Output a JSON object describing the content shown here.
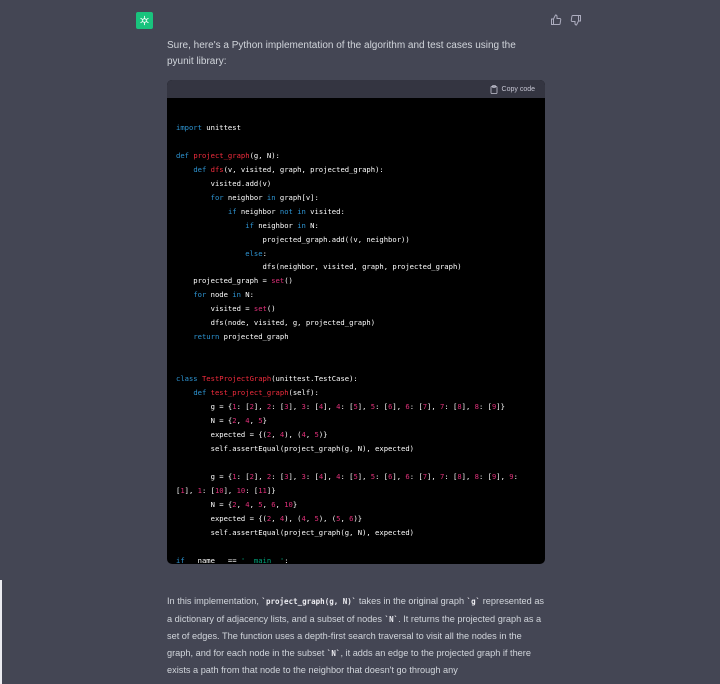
{
  "assistant": {
    "intro": "Sure, here's a Python implementation of the algorithm and test cases using the pyunit library:"
  },
  "code_block": {
    "copy_label": "Copy code",
    "lines": [
      [],
      [
        [
          "import",
          "k"
        ],
        [
          " unittest",
          ""
        ]
      ],
      [],
      [
        [
          "def",
          "k"
        ],
        [
          " ",
          ""
        ],
        [
          "project_graph",
          "f"
        ],
        [
          "(g, N):",
          ""
        ]
      ],
      [
        [
          "    ",
          ""
        ],
        [
          "def",
          "k"
        ],
        [
          " ",
          ""
        ],
        [
          "dfs",
          "f"
        ],
        [
          "(v, visited, graph, projected_graph):",
          ""
        ]
      ],
      [
        [
          "        visited.add(v)",
          ""
        ]
      ],
      [
        [
          "        ",
          ""
        ],
        [
          "for",
          "k"
        ],
        [
          " neighbor ",
          ""
        ],
        [
          "in",
          "k"
        ],
        [
          " graph[v]:",
          ""
        ]
      ],
      [
        [
          "            ",
          ""
        ],
        [
          "if",
          "k"
        ],
        [
          " neighbor ",
          ""
        ],
        [
          "not",
          "k"
        ],
        [
          " ",
          ""
        ],
        [
          "in",
          "k"
        ],
        [
          " visited:",
          ""
        ]
      ],
      [
        [
          "                ",
          ""
        ],
        [
          "if",
          "k"
        ],
        [
          " neighbor ",
          ""
        ],
        [
          "in",
          "k"
        ],
        [
          " N:",
          ""
        ]
      ],
      [
        [
          "                    projected_graph.add((v, neighbor))",
          ""
        ]
      ],
      [
        [
          "                ",
          ""
        ],
        [
          "else",
          "k"
        ],
        [
          ":",
          ""
        ]
      ],
      [
        [
          "                    dfs(neighbor, visited, graph, projected_graph)",
          ""
        ]
      ],
      [
        [
          "    projected_graph = ",
          ""
        ],
        [
          "set",
          "n"
        ],
        [
          "()",
          ""
        ]
      ],
      [
        [
          "    ",
          ""
        ],
        [
          "for",
          "k"
        ],
        [
          " node ",
          ""
        ],
        [
          "in",
          "k"
        ],
        [
          " N:",
          ""
        ]
      ],
      [
        [
          "        visited = ",
          ""
        ],
        [
          "set",
          "n"
        ],
        [
          "()",
          ""
        ]
      ],
      [
        [
          "        dfs(node, visited, g, projected_graph)",
          ""
        ]
      ],
      [
        [
          "    ",
          ""
        ],
        [
          "return",
          "k"
        ],
        [
          " projected_graph",
          ""
        ]
      ],
      [],
      [],
      [
        [
          "class",
          "k"
        ],
        [
          " ",
          ""
        ],
        [
          "TestProjectGraph",
          "f"
        ],
        [
          "(unittest.TestCase):",
          ""
        ]
      ],
      [
        [
          "    ",
          ""
        ],
        [
          "def",
          "k"
        ],
        [
          " ",
          ""
        ],
        [
          "test_project_graph",
          "f"
        ],
        [
          "(self):",
          ""
        ]
      ],
      [
        [
          "        g = {",
          ""
        ],
        [
          "1",
          "n"
        ],
        [
          ": [",
          ""
        ],
        [
          "2",
          "n"
        ],
        [
          "], ",
          ""
        ],
        [
          "2",
          "n"
        ],
        [
          ": [",
          ""
        ],
        [
          "3",
          "n"
        ],
        [
          "], ",
          ""
        ],
        [
          "3",
          "n"
        ],
        [
          ": [",
          ""
        ],
        [
          "4",
          "n"
        ],
        [
          "], ",
          ""
        ],
        [
          "4",
          "n"
        ],
        [
          ": [",
          ""
        ],
        [
          "5",
          "n"
        ],
        [
          "], ",
          ""
        ],
        [
          "5",
          "n"
        ],
        [
          ": [",
          ""
        ],
        [
          "6",
          "n"
        ],
        [
          "], ",
          ""
        ],
        [
          "6",
          "n"
        ],
        [
          ": [",
          ""
        ],
        [
          "7",
          "n"
        ],
        [
          "], ",
          ""
        ],
        [
          "7",
          "n"
        ],
        [
          ": [",
          ""
        ],
        [
          "8",
          "n"
        ],
        [
          "], ",
          ""
        ],
        [
          "8",
          "n"
        ],
        [
          ": [",
          ""
        ],
        [
          "9",
          "n"
        ],
        [
          "]}",
          ""
        ]
      ],
      [
        [
          "        N = {",
          ""
        ],
        [
          "2",
          "n"
        ],
        [
          ", ",
          ""
        ],
        [
          "4",
          "n"
        ],
        [
          ", ",
          ""
        ],
        [
          "5",
          "n"
        ],
        [
          "}",
          ""
        ]
      ],
      [
        [
          "        expected = {(",
          ""
        ],
        [
          "2",
          "n"
        ],
        [
          ", ",
          ""
        ],
        [
          "4",
          "n"
        ],
        [
          "), (",
          ""
        ],
        [
          "4",
          "n"
        ],
        [
          ", ",
          ""
        ],
        [
          "5",
          "n"
        ],
        [
          ")}",
          ""
        ]
      ],
      [
        [
          "        self.assertEqual(project_graph(g, N), expected)",
          ""
        ]
      ],
      [],
      [
        [
          "        g = {",
          ""
        ],
        [
          "1",
          "n"
        ],
        [
          ": [",
          ""
        ],
        [
          "2",
          "n"
        ],
        [
          "], ",
          ""
        ],
        [
          "2",
          "n"
        ],
        [
          ": [",
          ""
        ],
        [
          "3",
          "n"
        ],
        [
          "], ",
          ""
        ],
        [
          "3",
          "n"
        ],
        [
          ": [",
          ""
        ],
        [
          "4",
          "n"
        ],
        [
          "], ",
          ""
        ],
        [
          "4",
          "n"
        ],
        [
          ": [",
          ""
        ],
        [
          "5",
          "n"
        ],
        [
          "], ",
          ""
        ],
        [
          "5",
          "n"
        ],
        [
          ": [",
          ""
        ],
        [
          "6",
          "n"
        ],
        [
          "], ",
          ""
        ],
        [
          "6",
          "n"
        ],
        [
          ": [",
          ""
        ],
        [
          "7",
          "n"
        ],
        [
          "], ",
          ""
        ],
        [
          "7",
          "n"
        ],
        [
          ": [",
          ""
        ],
        [
          "8",
          "n"
        ],
        [
          "], ",
          ""
        ],
        [
          "8",
          "n"
        ],
        [
          ": [",
          ""
        ],
        [
          "9",
          "n"
        ],
        [
          "], ",
          ""
        ],
        [
          "9",
          "n"
        ],
        [
          ":",
          ""
        ]
      ],
      [
        [
          "[",
          ""
        ],
        [
          "1",
          "n"
        ],
        [
          "], ",
          ""
        ],
        [
          "1",
          "n"
        ],
        [
          ": [",
          ""
        ],
        [
          "10",
          "n"
        ],
        [
          "], ",
          ""
        ],
        [
          "10",
          "n"
        ],
        [
          ": [",
          ""
        ],
        [
          "11",
          "n"
        ],
        [
          "]}",
          ""
        ]
      ],
      [
        [
          "        N = {",
          ""
        ],
        [
          "2",
          "n"
        ],
        [
          ", ",
          ""
        ],
        [
          "4",
          "n"
        ],
        [
          ", ",
          ""
        ],
        [
          "5",
          "n"
        ],
        [
          ", ",
          ""
        ],
        [
          "6",
          "n"
        ],
        [
          ", ",
          ""
        ],
        [
          "10",
          "n"
        ],
        [
          "}",
          ""
        ]
      ],
      [
        [
          "        expected = {(",
          ""
        ],
        [
          "2",
          "n"
        ],
        [
          ", ",
          ""
        ],
        [
          "4",
          "n"
        ],
        [
          "), (",
          ""
        ],
        [
          "4",
          "n"
        ],
        [
          ", ",
          ""
        ],
        [
          "5",
          "n"
        ],
        [
          "), (",
          ""
        ],
        [
          "5",
          "n"
        ],
        [
          ", ",
          ""
        ],
        [
          "6",
          "n"
        ],
        [
          ")}",
          ""
        ]
      ],
      [
        [
          "        self.assertEqual(project_graph(g, N), expected)",
          ""
        ]
      ],
      [],
      [
        [
          "if",
          "k"
        ],
        [
          " __name__ == ",
          ""
        ],
        [
          "'__main__'",
          "s"
        ],
        [
          ":",
          ""
        ]
      ],
      [
        [
          "    unittest.main()",
          ""
        ]
      ]
    ]
  },
  "explanation": {
    "p1": "In this implementation, ",
    "c1": "`project_graph(g, N)`",
    "p2": " takes in the original graph ",
    "c2": "`g`",
    "p3": " represented as a dictionary of adjacency lists, and a subset of nodes ",
    "c3": "`N`",
    "p4": ". It returns the projected graph as a set of edges. The function uses a depth-first search traversal to visit all the nodes in the graph, and for each node in the subset ",
    "c4": "`N`",
    "p5": ", it adds an edge to the projected graph if there exists a path from that node to the neighbor that doesn't go through any"
  },
  "icons": {
    "avatar": "openai-logo-icon",
    "thumbs_up": "thumbs-up-icon",
    "thumbs_down": "thumbs-down-icon",
    "clipboard": "clipboard-icon"
  },
  "colors": {
    "background": "#444654",
    "code_bg": "#000000",
    "code_header": "#343541",
    "avatar": "#19c37d",
    "keyword": "#2e95d3",
    "function": "#f22c3d",
    "number": "#df3079",
    "string": "#00a67d"
  }
}
